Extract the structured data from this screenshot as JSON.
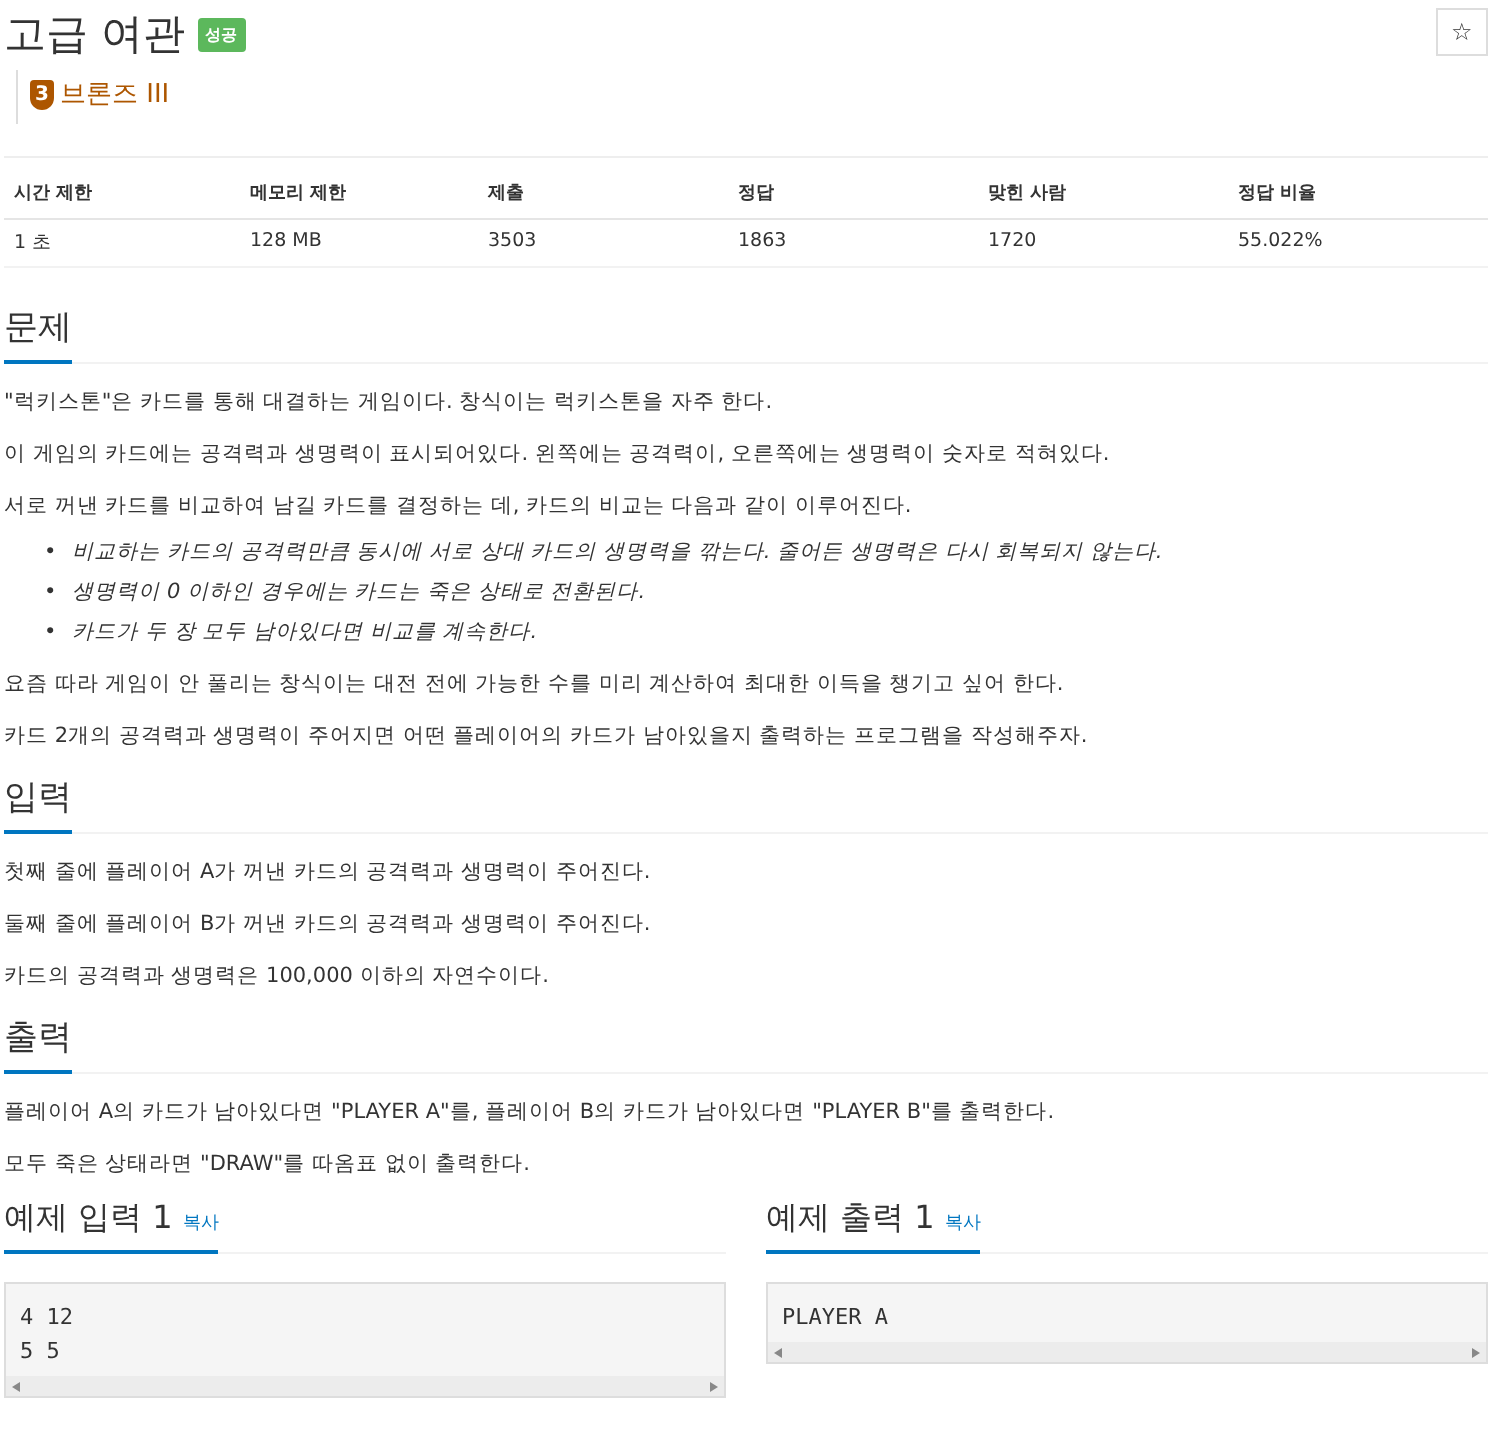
{
  "title": "고급 여관",
  "badge": "성공",
  "star_button": "☆",
  "tier": {
    "rank": "3",
    "name": "브론즈 III"
  },
  "stats": {
    "columns": [
      "시간 제한",
      "메모리 제한",
      "제출",
      "정답",
      "맞힌 사람",
      "정답 비율"
    ],
    "row": [
      "1 초",
      "128 MB",
      "3503",
      "1863",
      "1720",
      "55.022%"
    ]
  },
  "sections": [
    {
      "heading": "문제",
      "blocks": [
        {
          "kind": "paragraph",
          "text": "\"럭키스톤\"은 카드를 통해 대결하는 게임이다. 창식이는 럭키스톤을 자주 한다."
        },
        {
          "kind": "paragraph",
          "text": "이 게임의 카드에는 공격력과 생명력이 표시되어있다. 왼쪽에는 공격력이, 오른쪽에는 생명력이 숫자로 적혀있다."
        },
        {
          "kind": "paragraph",
          "text": "서로 꺼낸 카드를 비교하여 남길 카드를 결정하는 데, 카드의 비교는 다음과 같이 이루어진다."
        },
        {
          "kind": "list",
          "marker": "•",
          "items": [
            "비교하는 카드의 공격력만큼 동시에 서로 상대 카드의 생명력을 깎는다. 줄어든 생명력은 다시 회복되지 않는다.",
            "생명력이 0 이하인 경우에는 카드는 죽은 상태로 전환된다.",
            "카드가 두 장 모두 남아있다면 비교를 계속한다."
          ]
        },
        {
          "kind": "paragraph",
          "text": "요즘 따라 게임이 안 풀리는 창식이는 대전 전에 가능한 수를 미리 계산하여 최대한 이득을 챙기고 싶어 한다."
        },
        {
          "kind": "paragraph",
          "text": "카드 2개의 공격력과 생명력이 주어지면 어떤 플레이어의 카드가 남아있을지 출력하는 프로그램을 작성해주자."
        }
      ]
    },
    {
      "heading": "입력",
      "blocks": [
        {
          "kind": "paragraph",
          "text": "첫째 줄에 플레이어 A가 꺼낸 카드의 공격력과 생명력이 주어진다."
        },
        {
          "kind": "paragraph",
          "text": "둘째 줄에 플레이어 B가 꺼낸 카드의 공격력과 생명력이 주어진다."
        },
        {
          "kind": "paragraph",
          "text": "카드의 공격력과 생명력은 100,000 이하의 자연수이다."
        }
      ]
    },
    {
      "heading": "출력",
      "blocks": [
        {
          "kind": "paragraph",
          "text": "플레이어 A의 카드가 남아있다면 \"PLAYER A\"를, 플레이어 B의 카드가 남아있다면 \"PLAYER B\"를 출력한다."
        },
        {
          "kind": "paragraph",
          "text": "모두 죽은 상태라면 \"DRAW\"를 따옴표 없이 출력한다."
        }
      ]
    }
  ],
  "samples": [
    {
      "heading": "예제 입력 1",
      "copy": "복사",
      "lines": [
        "4 12",
        "5 5"
      ]
    },
    {
      "heading": "예제 출력 1",
      "copy": "복사",
      "lines": [
        "PLAYER A"
      ]
    }
  ]
}
